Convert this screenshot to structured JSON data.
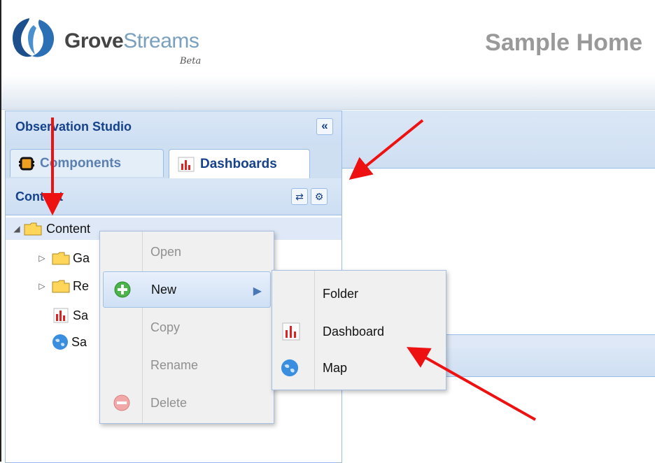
{
  "brand": {
    "name_bold": "Grove",
    "name_light": "Streams",
    "beta": "Beta"
  },
  "page_title": "Sample Home",
  "panel": {
    "title": "Observation Studio",
    "collapse_icon": "double-chevron-left-icon",
    "tabs": [
      {
        "label": "Components",
        "icon": "component-chip-icon"
      },
      {
        "label": "Dashboards",
        "icon": "dashboard-chart-icon"
      }
    ],
    "content_title": "Content",
    "tools": [
      {
        "icon": "refresh-icon"
      },
      {
        "icon": "gear-icon"
      }
    ]
  },
  "tree": [
    {
      "label": "Content",
      "icon": "folder-icon",
      "expanded": true
    },
    {
      "label": "Ga",
      "icon": "folder-icon"
    },
    {
      "label": "Re",
      "icon": "folder-icon"
    },
    {
      "label": "Sa",
      "icon": "dashboard-chart-icon"
    },
    {
      "label": "Sa",
      "icon": "globe-icon"
    }
  ],
  "context_menu": {
    "items": [
      {
        "label": "Open",
        "disabled": true
      },
      {
        "label": "New",
        "icon": "add-icon",
        "has_submenu": true
      },
      {
        "label": "Copy",
        "disabled": true
      },
      {
        "label": "Rename",
        "disabled": true
      },
      {
        "label": "Delete",
        "icon": "delete-icon",
        "disabled": true
      }
    ]
  },
  "submenu": {
    "items": [
      {
        "label": "Folder"
      },
      {
        "label": "Dashboard",
        "icon": "dashboard-chart-icon"
      },
      {
        "label": "Map",
        "icon": "globe-icon"
      }
    ]
  },
  "colors": {
    "annotation_arrow": "#ee1111",
    "panel_title": "#15428b"
  }
}
